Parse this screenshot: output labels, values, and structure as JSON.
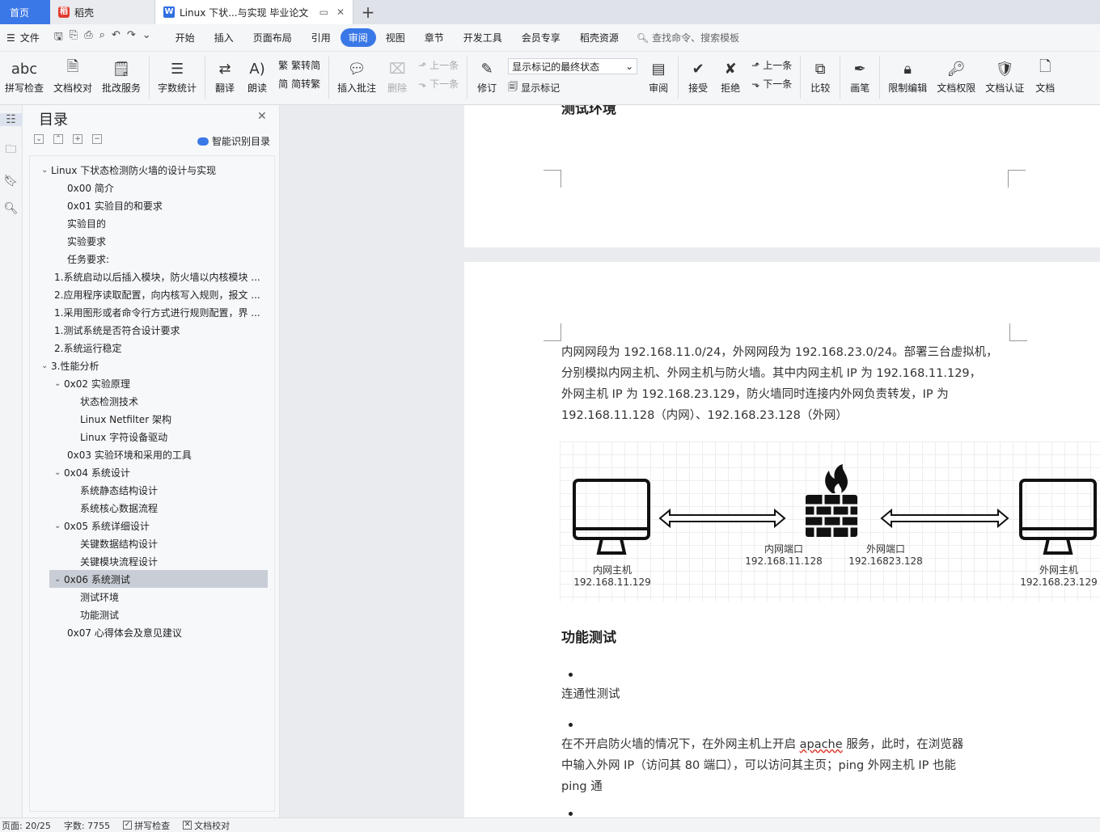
{
  "tabs": {
    "home": "首页",
    "docer": "稻壳",
    "active_doc": "Linux 下状...与实现 毕业论文",
    "new_tab": "+"
  },
  "menu": {
    "file": "文件",
    "items": [
      "开始",
      "插入",
      "页面布局",
      "引用",
      "审阅",
      "视图",
      "章节",
      "开发工具",
      "会员专享",
      "稻壳资源"
    ],
    "active": "审阅",
    "search_placeholder": "查找命令、搜索模板"
  },
  "ribbon": {
    "spell_check": "拼写检查",
    "doc_proof": "文档校对",
    "review_service": "批改服务",
    "word_count": "字数统计",
    "translate": "翻译",
    "read_aloud": "朗读",
    "trad_to_simp": "繁转简",
    "simp_to_trad": "简转繁",
    "insert_comment": "插入批注",
    "delete": "删除",
    "prev_comment": "上一条",
    "next_comment": "下一条",
    "revise": "修订",
    "markup_select": "显示标记的最终状态",
    "show_markup": "显示标记",
    "review": "审阅",
    "accept": "接受",
    "reject": "拒绝",
    "prev_change": "上一条",
    "next_change": "下一条",
    "compare": "比较",
    "pen": "画笔",
    "restrict_edit": "限制编辑",
    "doc_permission": "文档权限",
    "doc_cert": "文档认证",
    "doc_cut": "文档"
  },
  "outline": {
    "title": "目录",
    "smart_toc": "智能识别目录",
    "items": [
      {
        "text": "Linux 下状态检测防火墙的设计与实现",
        "level": 0,
        "caret": "⌄"
      },
      {
        "text": "0x00 简介",
        "level": 1,
        "caret": ""
      },
      {
        "text": "0x01 实验目的和要求",
        "level": 1,
        "caret": ""
      },
      {
        "text": "实验目的",
        "level": 1,
        "caret": ""
      },
      {
        "text": "实验要求",
        "level": 1,
        "caret": ""
      },
      {
        "text": "任务要求:",
        "level": 1,
        "caret": ""
      },
      {
        "text": "1.系统启动以后插入模块，防火墙以内核模块 ...",
        "level": 0,
        "caret": ""
      },
      {
        "text": "2.应用程序读取配置，向内核写入规则，报文 ...",
        "level": 0,
        "caret": ""
      },
      {
        "text": "1.采用图形或者命令行方式进行规则配置，界 ...",
        "level": 0,
        "caret": ""
      },
      {
        "text": "1.测试系统是否符合设计要求",
        "level": 0,
        "caret": ""
      },
      {
        "text": "2.系统运行稳定",
        "level": 0,
        "caret": ""
      },
      {
        "text": "3.性能分析",
        "level": 0,
        "caret": "⌄"
      },
      {
        "text": "0x02 实验原理",
        "level": 1,
        "caret": "⌄"
      },
      {
        "text": "状态检测技术",
        "level": 2,
        "caret": ""
      },
      {
        "text": "Linux Netfilter 架构",
        "level": 2,
        "caret": ""
      },
      {
        "text": "Linux 字符设备驱动",
        "level": 2,
        "caret": ""
      },
      {
        "text": "0x03 实验环境和采用的工具",
        "level": 1,
        "caret": ""
      },
      {
        "text": "0x04 系统设计",
        "level": 1,
        "caret": "⌄"
      },
      {
        "text": "系统静态结构设计",
        "level": 2,
        "caret": ""
      },
      {
        "text": "系统核心数据流程",
        "level": 2,
        "caret": ""
      },
      {
        "text": "0x05 系统详细设计",
        "level": 1,
        "caret": "⌄"
      },
      {
        "text": "关键数据结构设计",
        "level": 2,
        "caret": ""
      },
      {
        "text": "关键模块流程设计",
        "level": 2,
        "caret": ""
      },
      {
        "text": "0x06 系统测试",
        "level": 1,
        "caret": "⌄",
        "selected": true
      },
      {
        "text": "测试环境",
        "level": 2,
        "caret": ""
      },
      {
        "text": "功能测试",
        "level": 2,
        "caret": ""
      },
      {
        "text": "0x07 心得体会及意见建议",
        "level": 1,
        "caret": ""
      }
    ]
  },
  "document": {
    "page1_heading": "测试环境",
    "para1_lines": [
      "内网网段为  192.168.11.0/24，外网网段为  192.168.23.0/24。部署三台虚拟机，",
      "分别模拟内网主机、外网主机与防火墙。其中内网主机  IP  为  192.168.11.129，",
      "外网主机  IP  为  192.168.23.129，防火墙同时连接内外网负责转发，IP  为",
      "192.168.11.128（内网）、192.168.23.128（外网）"
    ],
    "diagram": {
      "inner_host_name": "内网主机",
      "inner_host_ip": "192.168.11.129",
      "inner_port_name": "内网端口",
      "inner_port_ip": "192.168.11.128",
      "outer_port_name": "外网端口",
      "outer_port_ip": "192.16823.128",
      "outer_host_name": "外网主机",
      "outer_host_ip": "192.168.23.129"
    },
    "heading2": "功能测试",
    "bullet1": "连通性测试",
    "para2_line1_pre": "在不开启防火墙的情况下，在外网主机上开启  ",
    "para2_line1_word": "apache",
    "para2_line1_post": "  服务，此时，在浏览器",
    "para2_line2": "中输入外网  IP（访问其  80  端口），可以访问其主页；ping  外网主机  IP  也能",
    "para2_line3": "ping  通"
  },
  "status": {
    "page": "页面: 20/25",
    "words": "字数: 7755",
    "spell_check": "拼写检查",
    "doc_proof": "文档校对"
  }
}
